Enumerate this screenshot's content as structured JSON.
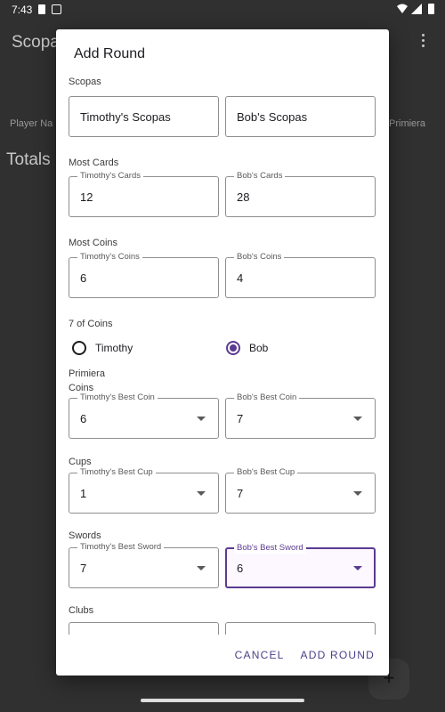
{
  "status_bar": {
    "time": "7:43"
  },
  "background": {
    "title": "Scopa",
    "col_player": "Player Na",
    "col_primiera": "Primiera",
    "totals": "Totals",
    "fab_label": "+"
  },
  "dialog": {
    "title": "Add Round",
    "scopas": {
      "heading": "Scopas",
      "left_placeholder": "Timothy's Scopas",
      "right_placeholder": "Bob's Scopas"
    },
    "most_cards": {
      "heading": "Most Cards",
      "left_label": "Timothy's Cards",
      "left_value": "12",
      "right_label": "Bob's Cards",
      "right_value": "28"
    },
    "most_coins": {
      "heading": "Most Coins",
      "left_label": "Timothy's Coins",
      "left_value": "6",
      "right_label": "Bob's Coins",
      "right_value": "4"
    },
    "seven_of_coins": {
      "heading": "7 of Coins",
      "options": [
        "Timothy",
        "Bob"
      ],
      "selected": "Bob"
    },
    "primiera": {
      "heading": "Primiera",
      "coins": {
        "heading": "Coins",
        "left_label": "Timothy's Best Coin",
        "left_value": "6",
        "right_label": "Bob's Best Coin",
        "right_value": "7"
      },
      "cups": {
        "heading": "Cups",
        "left_label": "Timothy's Best Cup",
        "left_value": "1",
        "right_label": "Bob's Best Cup",
        "right_value": "7"
      },
      "swords": {
        "heading": "Swords",
        "left_label": "Timothy's Best Sword",
        "left_value": "7",
        "right_label": "Bob's Best Sword",
        "right_value": "6"
      },
      "clubs": {
        "heading": "Clubs"
      }
    },
    "cancel_label": "CANCEL",
    "add_label": "ADD ROUND"
  },
  "colors": {
    "accent": "#5b3b91",
    "button_text": "#4b3e87",
    "scrim": "#303030"
  }
}
